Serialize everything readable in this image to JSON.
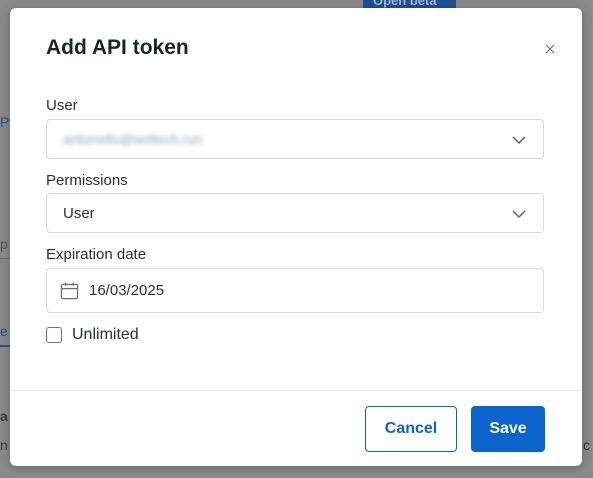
{
  "background": {
    "badge": "Open beta",
    "frag_p": "P",
    "frag_p2": "p",
    "frag_e": "e",
    "frag_a": "a",
    "frag_n": "n",
    "frag_c": "c"
  },
  "dialog": {
    "title": "Add API token",
    "close_icon": "close-icon",
    "user": {
      "label": "User",
      "value": "antonello@writech.run"
    },
    "permissions": {
      "label": "Permissions",
      "value": "User"
    },
    "expiration": {
      "label": "Expiration date",
      "value": "16/03/2025",
      "icon": "calendar-icon"
    },
    "unlimited": {
      "label": "Unlimited",
      "checked": false
    },
    "buttons": {
      "cancel": "Cancel",
      "save": "Save"
    }
  },
  "colors": {
    "primary": "#0b63ce",
    "overlay": "#8a8a8a",
    "border": "#d6d9dd"
  }
}
